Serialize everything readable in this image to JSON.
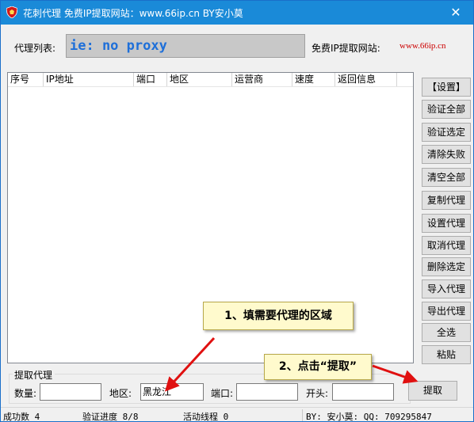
{
  "window": {
    "title": "花刺代理 免费IP提取网站：www.66ip.cn    BY安小莫",
    "close_glyph": "✕"
  },
  "header": {
    "proxy_list_label": "代理列表:",
    "proxy_value": "ie: no proxy",
    "free_site_label": "免费IP提取网站:",
    "site_link": "www.66ip.cn"
  },
  "table": {
    "columns": [
      "序号",
      "IP地址",
      "端口",
      "地区",
      "运营商",
      "速度",
      "返回信息"
    ],
    "rows": []
  },
  "sidebar": {
    "buttons": [
      "【设置】",
      "验证全部",
      "验证选定",
      "清除失败",
      "清空全部",
      "复制代理",
      "设置代理",
      "取消代理",
      "删除选定",
      "导入代理",
      "导出代理",
      "全选",
      "粘贴"
    ]
  },
  "fetch": {
    "group_title": "提取代理",
    "count_label": "数量:",
    "count_value": "",
    "region_label": "地区:",
    "region_value": "黑龙江",
    "port_label": "端口:",
    "port_value": "",
    "prefix_label": "开头:",
    "prefix_value": "",
    "button_label": "提取"
  },
  "status": {
    "success": "成功数 4",
    "progress": "验证进度 8/8",
    "threads": "活动线程 0",
    "author": "BY: 安小莫: QQ: 709295847"
  },
  "annotations": {
    "callout_1": "1、填需要代理的区域",
    "callout_2": "2、点击“提取”",
    "arrow_color": "#e01010"
  }
}
